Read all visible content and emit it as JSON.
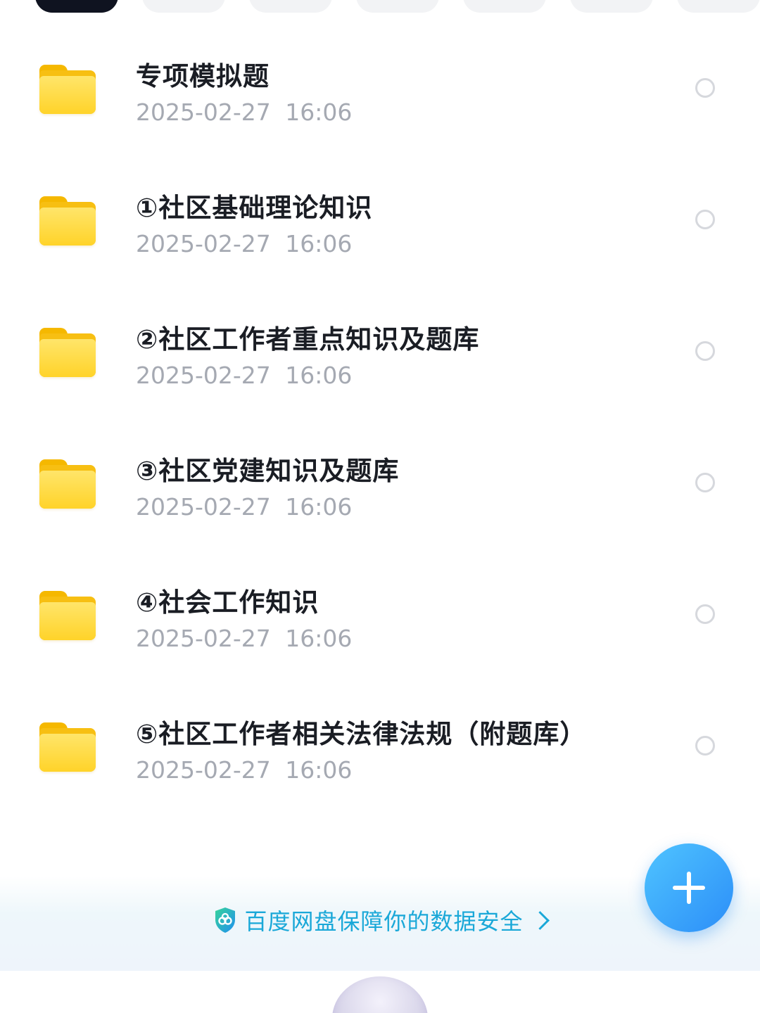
{
  "tabs": {
    "count": 7,
    "active_index": 0
  },
  "files": [
    {
      "name": "专项模拟题",
      "date": "2025-02-27",
      "time": "16:06"
    },
    {
      "name": "①社区基础理论知识",
      "date": "2025-02-27",
      "time": "16:06"
    },
    {
      "name": "②社区工作者重点知识及题库",
      "date": "2025-02-27",
      "time": "16:06"
    },
    {
      "name": "③社区党建知识及题库",
      "date": "2025-02-27",
      "time": "16:06"
    },
    {
      "name": "④社会工作知识",
      "date": "2025-02-27",
      "time": "16:06"
    },
    {
      "name": "⑤社区工作者相关法律法规（附题库）",
      "date": "2025-02-27",
      "time": "16:06"
    }
  ],
  "security_banner": {
    "text": "百度网盘保障你的数据安全",
    "icon": "shield-icon"
  },
  "fab": {
    "icon": "plus-icon"
  },
  "colors": {
    "folder": "#ffd329",
    "accent": "#1aa8d8",
    "fab": "#2c8ef8",
    "title_text": "#1a1d24",
    "meta_text": "#a5a9b2"
  }
}
